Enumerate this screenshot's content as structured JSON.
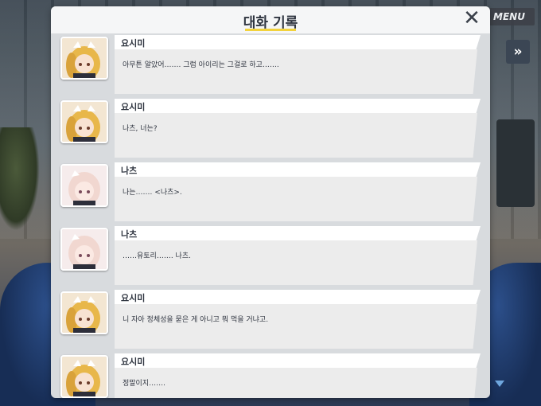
{
  "header": {
    "title": "대화 기록",
    "close_icon": "close-icon"
  },
  "controls": {
    "menu_label": "MENU",
    "skip_icon": "fast-forward-icon",
    "skip_label": "»"
  },
  "entries": [
    {
      "name": "요시미",
      "text": "아무튼 알았어……. 그럼 아이리는 그걸로 하고…….",
      "character": "yoshimi"
    },
    {
      "name": "요시미",
      "text": "나츠, 너는?",
      "character": "yoshimi"
    },
    {
      "name": "나츠",
      "text": "나는……. <나츠>.",
      "character": "natsu"
    },
    {
      "name": "나츠",
      "text": "……유토리……. 나츠.",
      "character": "natsu"
    },
    {
      "name": "요시미",
      "text": "니 자아 정체성을 묻은 게 아니고 뭐 먹을 거냐고.",
      "character": "yoshimi"
    },
    {
      "name": "요시미",
      "text": "정말이지…….",
      "character": "yoshimi"
    }
  ],
  "colors": {
    "title_underline": "#f2d23d",
    "yoshimi_hair": "#e8b74a",
    "natsu_hair": "#f1d7d0"
  }
}
